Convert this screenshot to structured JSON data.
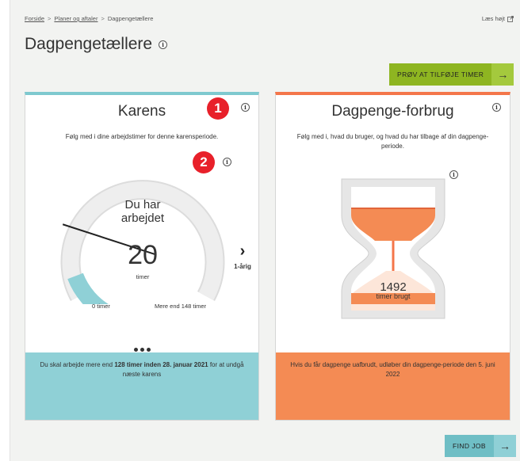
{
  "breadcrumb": {
    "home": "Forside",
    "sep1": ">",
    "plans": "Planer og aftaler",
    "sep2": ">",
    "current": "Dagpengetællere"
  },
  "read_aloud": "Læs højt",
  "page_title": "Dagpengetællere",
  "info_glyph": "i",
  "try_button": {
    "label": "PRØV AT TILFØJE TIMER",
    "arrow": "→"
  },
  "find_job_button": {
    "label": "FIND JOB",
    "arrow": "→"
  },
  "karens": {
    "title": "Karens",
    "subtitle": "Følg med i dine arbejdstimer for denne karensperiode.",
    "badge1": "1",
    "badge2": "2",
    "gauge": {
      "line1": "Du har",
      "line2": "arbejdet",
      "value": "20",
      "unit": "timer",
      "min_label": "0 timer",
      "max_label": "Mere end 148 timer",
      "fill_fraction": 0.135
    },
    "next": {
      "chevron": "›",
      "label": "1-årig"
    },
    "footer": {
      "pre": "Du skal arbejde mere end ",
      "bold": "128 timer inden 28. januar 2021",
      "post": " for at undgå næste karens"
    }
  },
  "forbrug": {
    "title": "Dagpenge-forbrug",
    "subtitle": "Følg med i, hvad du bruger, og hvad du har tilbage af din dagpenge-periode.",
    "value": "1492",
    "value_label": "timer brugt",
    "footer": "Hvis du får dagpenge uafbrudt, udløber din dagpenge-periode den 5. juni 2022"
  },
  "colors": {
    "teal": "#7ec9cf",
    "orange": "#f4764a",
    "green": "#8eb521",
    "red_badge": "#e8202a"
  }
}
